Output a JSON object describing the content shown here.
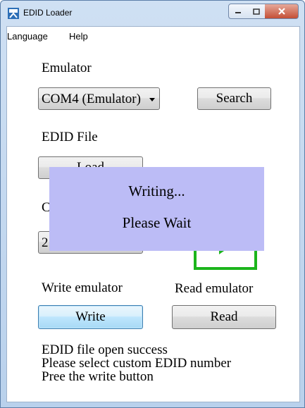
{
  "window": {
    "title": "EDID Loader"
  },
  "menu": {
    "language": "Language",
    "help": "Help"
  },
  "emulator": {
    "label": "Emulator",
    "port_value": "COM4 (Emulator)",
    "search_label": "Search"
  },
  "edid_file": {
    "label": "EDID File",
    "load_label": "Load",
    "partial_label": "C",
    "partial_value": "2"
  },
  "overlay": {
    "line1": "Writing...",
    "line2": "Please Wait"
  },
  "write": {
    "label": "Write emulator",
    "button": "Write"
  },
  "read": {
    "label": "Read emulator",
    "button": "Read"
  },
  "status": {
    "lines": [
      "EDID file open success",
      "Please select custom EDID number",
      "Pree the write button"
    ]
  },
  "colors": {
    "overlay_bg": "#bcbcf6",
    "green_accent": "#1cb51c"
  }
}
